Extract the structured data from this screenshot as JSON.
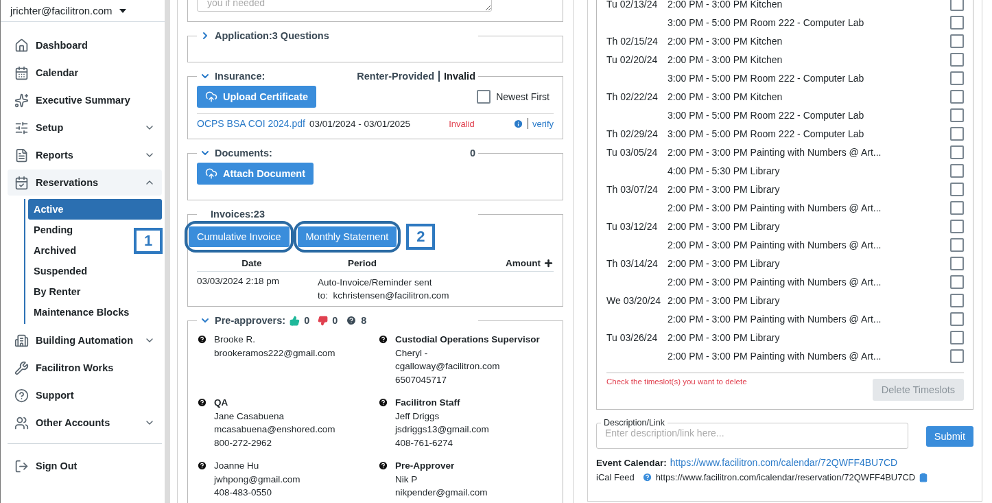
{
  "account": {
    "email": "jrichter@facilitron.com"
  },
  "sidebar": {
    "items": [
      {
        "label": "Dashboard"
      },
      {
        "label": "Calendar"
      },
      {
        "label": "Executive Summary"
      },
      {
        "label": "Setup",
        "expanded": false
      },
      {
        "label": "Reports",
        "expanded": false
      },
      {
        "label": "Reservations",
        "expanded": true,
        "children": [
          {
            "label": "Active",
            "selected": true
          },
          {
            "label": "Pending",
            "selected": false
          },
          {
            "label": "Archived",
            "selected": false
          },
          {
            "label": "Suspended",
            "selected": false
          },
          {
            "label": "By Renter",
            "selected": false
          },
          {
            "label": "Maintenance Blocks",
            "selected": false
          }
        ]
      },
      {
        "label": "Building Automation",
        "expanded": false
      },
      {
        "label": "Facilitron Works"
      },
      {
        "label": "Support"
      },
      {
        "label": "Other Accounts",
        "expanded": false
      }
    ],
    "sign_out": "Sign Out"
  },
  "notes": {
    "placeholder": "you if needed"
  },
  "application": {
    "title": "Application:3 Questions",
    "expanded": false
  },
  "insurance": {
    "title": "Insurance:",
    "expanded": true,
    "provider": "Renter-Provided",
    "status": "Invalid",
    "upload_button": "Upload Certificate",
    "newest_first": {
      "label": "Newest First",
      "checked": false
    },
    "certificate": {
      "file": "OCPS BSA COI 2024.pdf",
      "dates": "03/01/2024 - 03/01/2025",
      "status": "Invalid",
      "verify": "verify"
    }
  },
  "documents": {
    "title": "Documents:",
    "expanded": true,
    "count": "0",
    "attach_button": "Attach Document"
  },
  "invoices": {
    "title": "Invoices:23",
    "buttons": [
      {
        "label": "Cumulative Invoice",
        "callout": "1"
      },
      {
        "label": "Monthly Statement",
        "callout": "2"
      }
    ],
    "columns": [
      "Date",
      "Period",
      "Amount"
    ],
    "rows": [
      {
        "date": "03/03/2024 2:18 pm",
        "period": [
          "Auto-Invoice/Reminder sent",
          "to:  kchristensen@facilitron.com"
        ]
      }
    ]
  },
  "preapprovers": {
    "title": "Pre-approvers:",
    "expanded": true,
    "approved": "0",
    "rejected": "0",
    "pending": "8",
    "entries": [
      {
        "lines": [
          "Brooke R.",
          "brookeramos222@gmail.com"
        ]
      },
      {
        "role": "Custodial Operations Supervisor",
        "lines": [
          "Cheryl -",
          "cgalloway@facilitron.com",
          "6507045717"
        ]
      },
      {
        "role": "QA",
        "lines": [
          "Jane Casabuena",
          "mcasabuena@enshored.com",
          "800-272-2962"
        ]
      },
      {
        "role": "Facilitron Staff",
        "lines": [
          "Jeff Driggs",
          "jsdriggs13@gmail.com",
          "408-761-6274"
        ]
      },
      {
        "lines": [
          "Joanne Hu",
          "jwhpong@gmail.com",
          "408-483-0550"
        ]
      },
      {
        "role": "Pre-Approver",
        "lines": [
          "Nik P",
          "nikpender@gmail.com"
        ]
      }
    ]
  },
  "timeslots": [
    {
      "day": "Tu 02/13/24",
      "slot": "2:00 PM - 3:00 PM Kitchen",
      "checked": false
    },
    {
      "slot": "3:00 PM - 5:00 PM Room 222 - Computer Lab",
      "checked": false
    },
    {
      "day": "Th 02/15/24",
      "slot": "2:00 PM - 3:00 PM Kitchen",
      "checked": false
    },
    {
      "day": "Tu 02/20/24",
      "slot": "2:00 PM - 3:00 PM Kitchen",
      "checked": false
    },
    {
      "slot": "3:00 PM - 5:00 PM Room 222 - Computer Lab",
      "checked": false
    },
    {
      "day": "Th 02/22/24",
      "slot": "2:00 PM - 3:00 PM Kitchen",
      "checked": false
    },
    {
      "slot": "3:00 PM - 5:00 PM Room 222 - Computer Lab",
      "checked": false
    },
    {
      "day": "Th 02/29/24",
      "slot": "3:00 PM - 5:00 PM Room 222 - Computer Lab",
      "checked": false
    },
    {
      "day": "Tu 03/05/24",
      "slot": "2:00 PM - 3:00 PM Painting with Numbers @ Art...",
      "checked": false
    },
    {
      "slot": "4:00 PM - 5:30 PM Library",
      "checked": false
    },
    {
      "day": "Th 03/07/24",
      "slot": "2:00 PM - 3:00 PM Library",
      "checked": false
    },
    {
      "slot": "2:00 PM - 3:00 PM Painting with Numbers @ Art...",
      "checked": false
    },
    {
      "day": "Tu 03/12/24",
      "slot": "2:00 PM - 3:00 PM Library",
      "checked": false
    },
    {
      "slot": "2:00 PM - 3:00 PM Painting with Numbers @ Art...",
      "checked": false
    },
    {
      "day": "Th 03/14/24",
      "slot": "2:00 PM - 3:00 PM Library",
      "checked": false
    },
    {
      "slot": "2:00 PM - 3:00 PM Painting with Numbers @ Art...",
      "checked": false
    },
    {
      "day": "We 03/20/24",
      "slot": "2:00 PM - 3:00 PM Library",
      "checked": false
    },
    {
      "slot": "2:00 PM - 3:00 PM Painting with Numbers @ Art...",
      "checked": false
    },
    {
      "day": "Tu 03/26/24",
      "slot": "2:00 PM - 3:00 PM Library",
      "checked": false
    },
    {
      "slot": "2:00 PM - 3:00 PM Painting with Numbers @ Art...",
      "checked": false
    }
  ],
  "timeslot_hint": "Check the timeslot(s) you want to delete",
  "delete_button": {
    "label": "Delete Timeslots",
    "disabled": true
  },
  "description": {
    "label": "Description/Link",
    "placeholder": "Enter description/link here..."
  },
  "submit_button": "Submit",
  "event_calendar": {
    "label": "Event Calendar:",
    "url": "https://www.facilitron.com/calendar/72QWFF4BU7CD"
  },
  "ical_feed": {
    "label": "iCal Feed",
    "url": "https://www.facilitron.com/icalendar/reservation/72QWFF4BU7CD"
  }
}
